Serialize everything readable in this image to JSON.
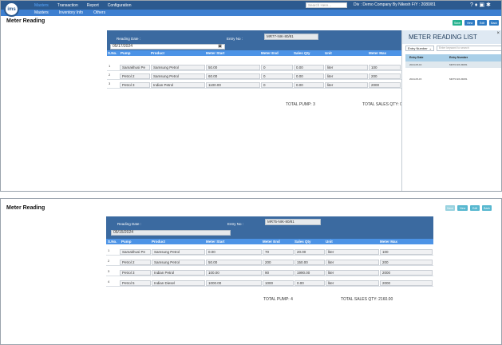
{
  "header": {
    "logo_text": "ims",
    "nav": [
      "Masters",
      "Transaction",
      "Report",
      "Configuration"
    ],
    "subnav": [
      "Masters",
      "Inventory Info",
      "Others"
    ],
    "search_placeholder": "Search Here...",
    "company": "Div : Demo Company By Nikesh   F/Y : 2080/81",
    "icons": [
      "help-icon",
      "bell-icon",
      "print-icon",
      "settings-icon"
    ]
  },
  "page_title": "Meter Reading",
  "buttons": {
    "save": "Save",
    "view": "View",
    "edit": "Edit",
    "back": "Back"
  },
  "form_labels": {
    "reading_date": "Reading Date :",
    "entry_no": "Entry No :"
  },
  "columns": [
    "S.No.",
    "Pump",
    "Product",
    "Meter Start",
    "Meter End",
    "Sales Qty",
    "Unit",
    "Meter Max"
  ],
  "top_form": {
    "reading_date": "05/17/2024",
    "entry_no": "MR77-NIK-80/81",
    "rows": [
      {
        "sno": "1",
        "pump": "Samakhusi Pe",
        "product": "Samsung Petrol",
        "meter_start": "50.00",
        "meter_end": "0",
        "sales_qty": "0.00",
        "unit": "liter",
        "meter_max": "100"
      },
      {
        "sno": "2",
        "pump": "Petrol 2",
        "product": "Samsung Petrol",
        "meter_start": "60.00",
        "meter_end": "0",
        "sales_qty": "0.00",
        "unit": "liter",
        "meter_max": "200"
      },
      {
        "sno": "3",
        "pump": "Petrol 3",
        "product": "Indian Petrol",
        "meter_start": "1100.00",
        "meter_end": "0",
        "sales_qty": "0.00",
        "unit": "liter",
        "meter_max": "2000"
      }
    ],
    "total_pump": "TOTAL PUMP: 3",
    "total_sales": "TOTAL SALES QTY: 0.00"
  },
  "list_panel": {
    "title": "METER READING LIST",
    "close": "×",
    "filter_select": "Entry Number",
    "filter_placeholder": "Enter keyword to search",
    "headers": [
      "Entry Date",
      "Entry Number"
    ],
    "rows": [
      {
        "date": "2024-05-16",
        "number": "MR76-NIK-80/81"
      },
      {
        "date": "2024-05-15",
        "number": "MR75-NIK-80/81"
      }
    ]
  },
  "bottom_form": {
    "reading_date": "05/15/2024",
    "entry_no": "MR75-NIK-80/81",
    "rows": [
      {
        "sno": "1",
        "pump": "Samakhusi Pe",
        "product": "Samsung Petrol",
        "meter_start": "0.00",
        "meter_end": "70",
        "sales_qty": "20.00",
        "unit": "liter",
        "meter_max": "100"
      },
      {
        "sno": "2",
        "pump": "Petrol 2",
        "product": "Samsung Petrol",
        "meter_start": "50.00",
        "meter_end": "200",
        "sales_qty": "150.00",
        "unit": "liter",
        "meter_max": "200"
      },
      {
        "sno": "3",
        "pump": "Petrol 3",
        "product": "Indian Petrol",
        "meter_start": "100.00",
        "meter_end": "90",
        "sales_qty": "1990.00",
        "unit": "liter",
        "meter_max": "2000"
      },
      {
        "sno": "4",
        "pump": "Petrol 5",
        "product": "Indian Diesel",
        "meter_start": "1000.00",
        "meter_end": "1000",
        "sales_qty": "0.00",
        "unit": "liter",
        "meter_max": "2000"
      }
    ],
    "total_pump": "TOTAL PUMP: 4",
    "total_sales": "TOTAL SALES QTY: 2160.00"
  }
}
